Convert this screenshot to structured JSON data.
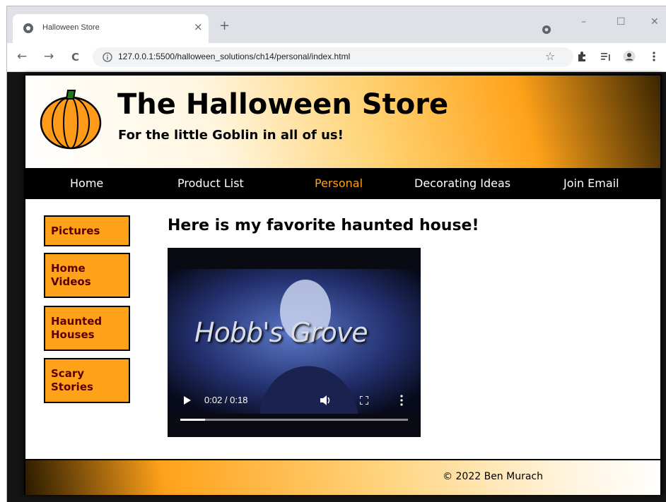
{
  "browser": {
    "tab_title": "Halloween Store",
    "tab_close": "×",
    "new_tab": "+",
    "url": "127.0.0.1:5500/halloween_solutions/ch14/personal/index.html",
    "window_controls": {
      "minimize": "–",
      "maximize": "☐",
      "close": "✕"
    },
    "nav": {
      "back": "←",
      "forward": "→",
      "reload": "C"
    },
    "bookmark": "☆"
  },
  "site": {
    "title": "The Halloween Store",
    "tagline": "For the little Goblin in all of us!"
  },
  "navbar": {
    "items": [
      {
        "label": "Home"
      },
      {
        "label": "Product List"
      },
      {
        "label": "Personal"
      },
      {
        "label": "Decorating Ideas"
      },
      {
        "label": "Join Email"
      }
    ],
    "active": "Personal"
  },
  "sidebar": {
    "items": [
      {
        "line1": "Pictures",
        "line2": ""
      },
      {
        "line1": "Home",
        "line2": "Videos"
      },
      {
        "line1": "Haunted",
        "line2": "Houses"
      },
      {
        "line1": "Scary",
        "line2": "Stories"
      }
    ]
  },
  "main": {
    "heading": "Here is my favorite haunted house!",
    "video": {
      "caption": "Hobb's Grove",
      "current_time": "0:02",
      "duration": "0:18",
      "time_display": "0:02 / 0:18",
      "progress_fraction": 0.11
    }
  },
  "footer": {
    "text": "© 2022 Ben Murach"
  },
  "colors": {
    "accent": "#ffa21a",
    "nav_background": "#000000",
    "sidebar_text": "#5a0000"
  },
  "icons": [
    "chrome-favicon",
    "tab-search-icon",
    "info-icon",
    "star-icon",
    "extensions-icon",
    "reading-list-icon",
    "profile-icon",
    "menu-icon",
    "pumpkin-logo",
    "play-icon",
    "volume-icon",
    "fullscreen-icon",
    "more-options-icon"
  ]
}
